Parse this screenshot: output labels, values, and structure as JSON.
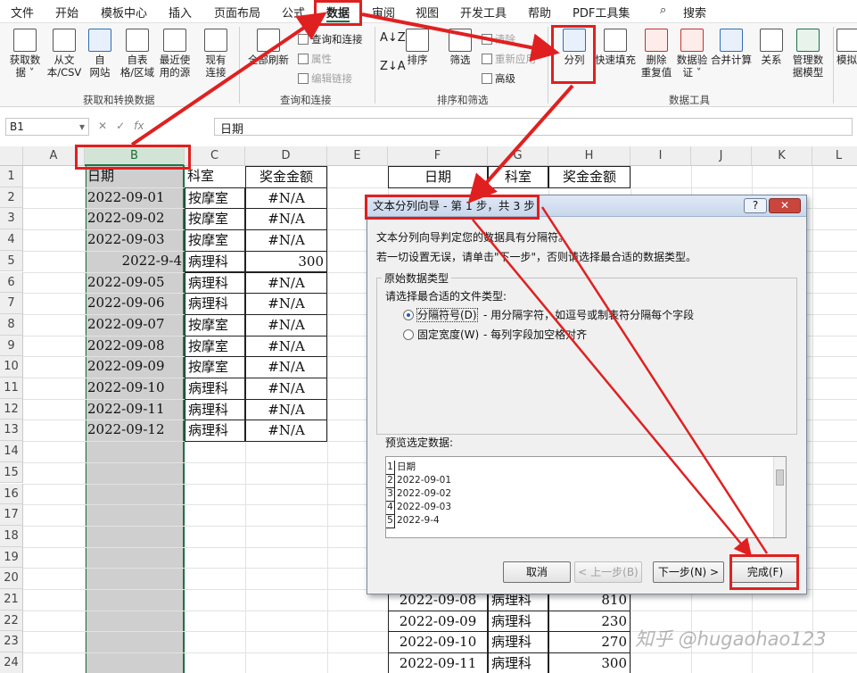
{
  "menubar": {
    "tabs": [
      "文件",
      "开始",
      "模板中心",
      "插入",
      "页面布局",
      "公式",
      "数据",
      "审阅",
      "视图",
      "开发工具",
      "帮助",
      "PDF工具集"
    ],
    "active_tab": "数据",
    "search": "搜索"
  },
  "ribbon": {
    "get_data": {
      "buttons": [
        "获取数\n据 ˅",
        "从文\n本/CSV",
        "自\n网站",
        "自表\n格/区域",
        "最近使\n用的源",
        "现有\n连接"
      ],
      "group": "获取和转换数据"
    },
    "queries": {
      "refresh": "全部刷新",
      "small": [
        "查询和连接",
        "属性",
        "编辑链接"
      ],
      "group": "查询和连接"
    },
    "sort_filter": {
      "sort": "排序",
      "filter": "筛选",
      "small": [
        "清除",
        "重新应用",
        "高级"
      ],
      "group": "排序和筛选"
    },
    "data_tools": {
      "buttons": [
        "分列",
        "快速填充",
        "删除\n重复值",
        "数据验\n证 ˅",
        "合并计算",
        "关系",
        "管理数\n据模型"
      ],
      "group": "数据工具"
    },
    "forecast": "模拟"
  },
  "formula_bar": {
    "name_box": "B1",
    "fx": "fx",
    "content": "日期"
  },
  "grid": {
    "columns": [
      "A",
      "B",
      "C",
      "D",
      "E",
      "F",
      "G",
      "H",
      "I",
      "J",
      "K",
      "L"
    ],
    "rows": [
      "1",
      "2",
      "3",
      "4",
      "5",
      "6",
      "7",
      "8",
      "9",
      "10",
      "11",
      "12",
      "13",
      "14",
      "15",
      "16",
      "17",
      "18",
      "19",
      "20",
      "21",
      "22",
      "23",
      "24"
    ],
    "left_table": {
      "header": [
        "日期",
        "科室",
        "奖金金额"
      ],
      "rows": [
        [
          "2022-09-01",
          "按摩室",
          "#N/A"
        ],
        [
          "2022-09-02",
          "按摩室",
          "#N/A"
        ],
        [
          "2022-09-03",
          "按摩室",
          "#N/A"
        ],
        [
          "2022-9-4",
          "病理科",
          "300"
        ],
        [
          "2022-09-05",
          "病理科",
          "#N/A"
        ],
        [
          "2022-09-06",
          "病理科",
          "#N/A"
        ],
        [
          "2022-09-07",
          "按摩室",
          "#N/A"
        ],
        [
          "2022-09-08",
          "按摩室",
          "#N/A"
        ],
        [
          "2022-09-09",
          "按摩室",
          "#N/A"
        ],
        [
          "2022-09-10",
          "病理科",
          "#N/A"
        ],
        [
          "2022-09-11",
          "病理科",
          "#N/A"
        ],
        [
          "2022-09-12",
          "病理科",
          "#N/A"
        ]
      ]
    },
    "right_table": {
      "header": [
        "日期",
        "科室",
        "奖金金额"
      ],
      "bottom_rows": [
        [
          "2022-09-08",
          "病理科",
          "810"
        ],
        [
          "2022-09-09",
          "病理科",
          "230"
        ],
        [
          "2022-09-10",
          "病理科",
          "270"
        ],
        [
          "2022-09-11",
          "病理科",
          "300"
        ]
      ]
    }
  },
  "dialog": {
    "title": "文本分列向导 - 第 1 步，共 3 步",
    "help": "?",
    "close": "✕",
    "line1": "文本分列向导判定您的数据具有分隔符。",
    "line2": "若一切设置无误，请单击\"下一步\"，否则请选择最合适的数据类型。",
    "fieldset_legend": "原始数据类型",
    "choose_label": "请选择最合适的文件类型:",
    "option1": "分隔符号(D)",
    "option1_desc": "- 用分隔字符，如逗号或制表符分隔每个字段",
    "option2": "固定宽度(W)",
    "option2_desc": "- 每列字段加空格对齐",
    "preview_label": "预览选定数据:",
    "preview_rows": [
      {
        "n": "1",
        "text": "日期"
      },
      {
        "n": "2",
        "text": "2022-09-01"
      },
      {
        "n": "3",
        "text": "2022-09-02"
      },
      {
        "n": "4",
        "text": "2022-09-03"
      },
      {
        "n": "5",
        "text": "2022-9-4"
      }
    ],
    "buttons": {
      "cancel": "取消",
      "back": "< 上一步(B)",
      "next": "下一步(N) >",
      "finish": "完成(F)"
    }
  },
  "watermark": "知乎 @hugaohao123",
  "colors": {
    "accent": "#217346",
    "highlight": "#e02020",
    "selected_column": "#cfcfcf"
  }
}
